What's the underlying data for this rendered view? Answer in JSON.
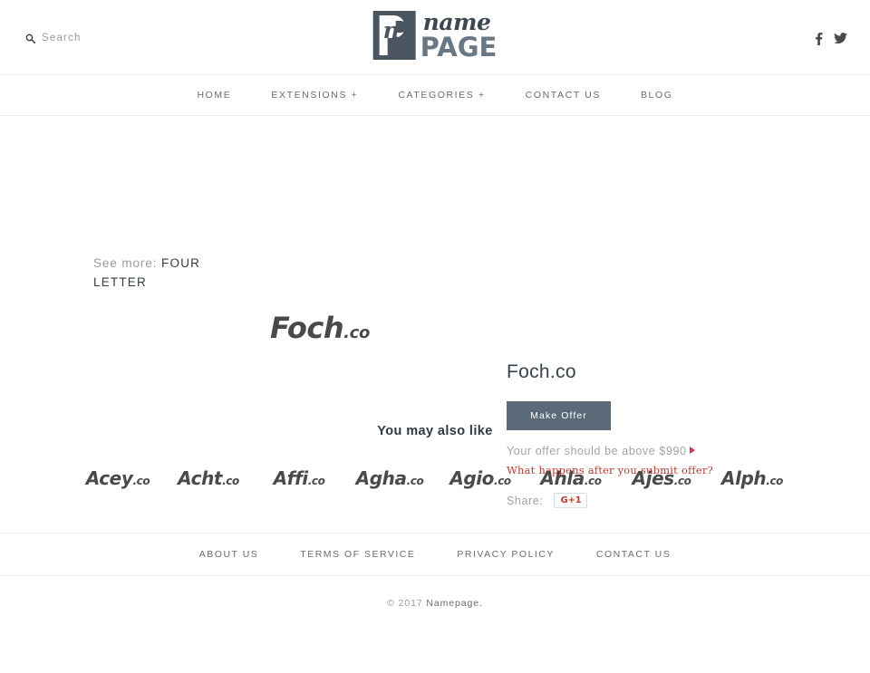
{
  "header": {
    "search": {
      "label": "Search",
      "icon": "search-icon"
    },
    "logo": {
      "mark_letter": "P",
      "script_letter": "n",
      "name_word": "name",
      "page_word": "PAGE"
    },
    "social": [
      {
        "name": "facebook-icon",
        "label": "f"
      },
      {
        "name": "twitter-icon",
        "label": "t"
      }
    ]
  },
  "nav": {
    "items": [
      {
        "label": "HOME"
      },
      {
        "label": "EXTENSIONS +"
      },
      {
        "label": "CATEGORIES +"
      },
      {
        "label": "CONTACT US"
      },
      {
        "label": "BLOG"
      }
    ]
  },
  "main": {
    "see_more_prefix": "See more:",
    "see_more_category": "FOUR LETTER",
    "art": {
      "name": "Foch",
      "tld": ".co"
    },
    "offer": {
      "title": "Foch.co",
      "button_label": "Make Offer",
      "note": "Your offer should be above $990",
      "minimum_price": "$990",
      "help_link": "What happens after you submit offer?",
      "share_label": "Share:",
      "gplus_label": "G+1",
      "button_color": "#5b6a78",
      "help_color": "#c0392b",
      "arrow_color": "#d0344a"
    }
  },
  "also_like": {
    "title": "You may also like",
    "items": [
      {
        "name": "Acey",
        "tld": ".co"
      },
      {
        "name": "Acht",
        "tld": ".co"
      },
      {
        "name": "Affi",
        "tld": ".co"
      },
      {
        "name": "Agha",
        "tld": ".co"
      },
      {
        "name": "Agio",
        "tld": ".co"
      },
      {
        "name": "Ahla",
        "tld": ".co"
      },
      {
        "name": "Ajes",
        "tld": ".co"
      },
      {
        "name": "Alph",
        "tld": ".co"
      }
    ]
  },
  "footer": {
    "links": [
      {
        "label": "ABOUT US"
      },
      {
        "label": "TERMS OF SERVICE"
      },
      {
        "label": "PRIVACY POLICY"
      },
      {
        "label": "CONTACT US"
      }
    ],
    "copyright_prefix": "© 2017",
    "copyright_name": "Namepage."
  }
}
